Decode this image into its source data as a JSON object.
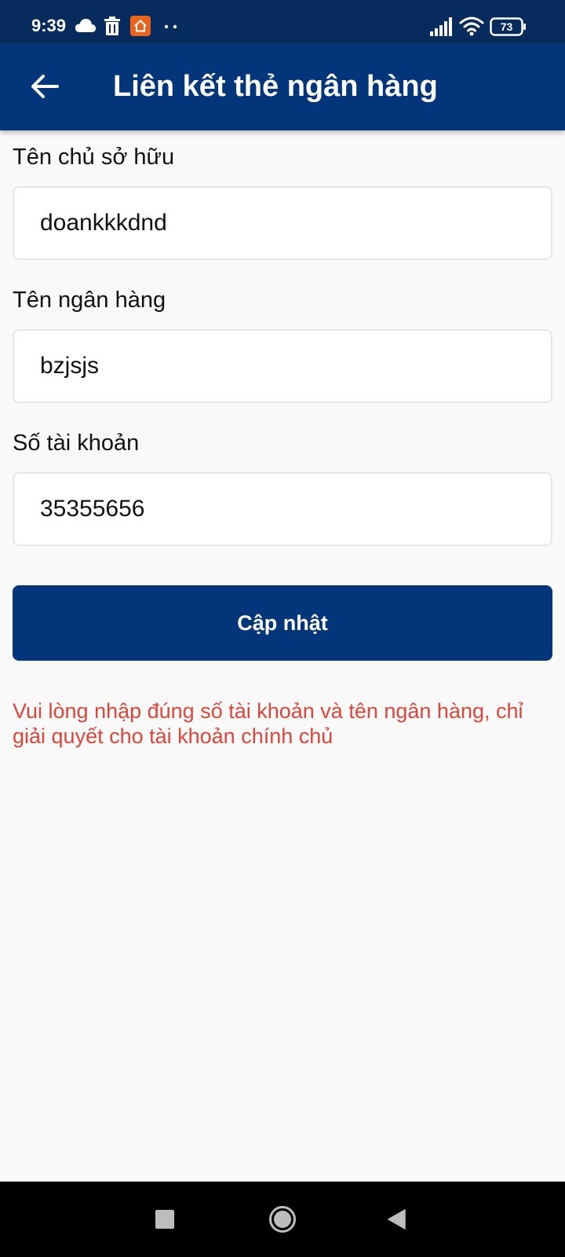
{
  "status_bar": {
    "time": "9:39",
    "icons": [
      "cloud-icon",
      "trash-icon",
      "app-notification-icon",
      "more-dots-icon",
      "signal-icon",
      "wifi-icon",
      "battery-icon"
    ],
    "battery": "73"
  },
  "app_bar": {
    "title": "Liên kết thẻ ngân hàng",
    "back_icon": "back-arrow-icon"
  },
  "form": {
    "owner": {
      "label": "Tên chủ sở hữu",
      "value": "doankkkdnd"
    },
    "bank": {
      "label": "Tên ngân hàng",
      "value": "bzjsjs"
    },
    "account": {
      "label": "Số tài khoản",
      "value": "35355656"
    },
    "submit_label": "Cập nhật",
    "warning": "Vui lòng nhập đúng số tài khoản và tên ngân hàng, chỉ giải quyết cho tài khoản chính chủ"
  },
  "nav_bar": {
    "icons": [
      "recents-icon",
      "home-icon",
      "back-icon"
    ]
  },
  "colors": {
    "primary": "#03357a",
    "status_bar": "#062b5c",
    "warning": "#e0453a",
    "background": "#f9f9f9"
  }
}
